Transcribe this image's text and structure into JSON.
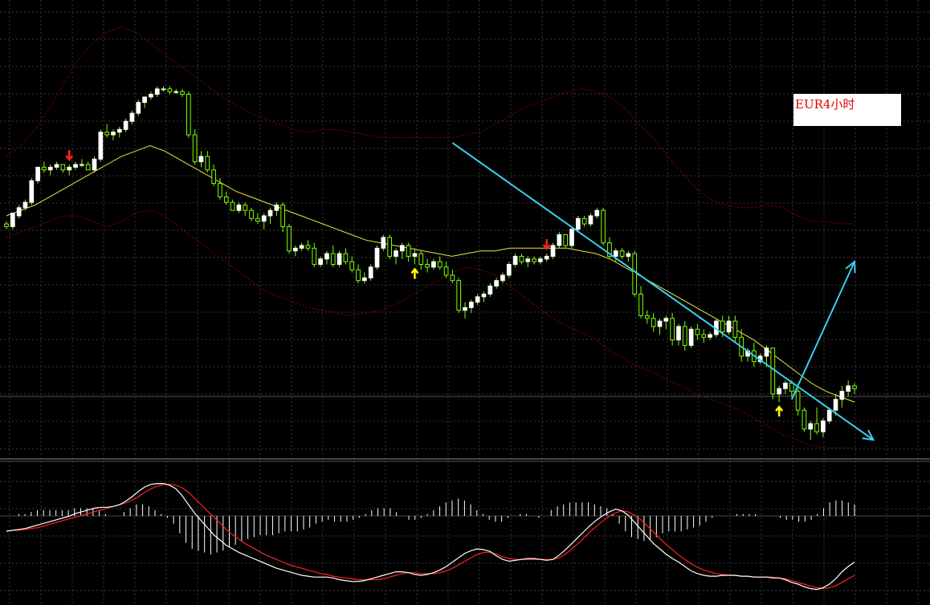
{
  "chart_label": "EUR4小时",
  "colors": {
    "background": "#000000",
    "grid": "#3a3a3a",
    "bull_candle": "#ffffff",
    "candle_wick": "#7fff00",
    "moving_average": "#e8e840",
    "bollinger_band": "#8b0000",
    "trendline": "#3ad0f0",
    "macd_line": "#ffffff",
    "signal_line": "#ff2020",
    "histogram": "#ffffff",
    "arrow_up": "#ffff00",
    "arrow_down": "#ff2020"
  },
  "chart_data": {
    "type": "candlestick",
    "price_panel": {
      "ylim": [
        0,
        100
      ],
      "candles": [
        [
          23,
          24,
          21,
          22
        ],
        [
          22,
          27,
          21,
          27
        ],
        [
          26,
          30,
          25,
          29
        ],
        [
          29,
          32,
          28,
          31
        ],
        [
          31,
          40,
          30,
          39
        ],
        [
          39,
          44,
          38,
          44
        ],
        [
          44,
          46,
          42,
          43
        ],
        [
          43,
          45,
          41,
          44
        ],
        [
          44,
          46,
          43,
          45
        ],
        [
          45,
          45,
          42,
          43
        ],
        [
          43,
          45,
          41,
          44
        ],
        [
          44,
          46,
          43,
          45
        ],
        [
          45,
          47,
          44,
          45
        ],
        [
          45,
          46,
          43,
          43
        ],
        [
          43,
          48,
          42,
          47
        ],
        [
          47,
          58,
          46,
          57
        ],
        [
          57,
          60,
          55,
          56
        ],
        [
          56,
          58,
          54,
          57
        ],
        [
          57,
          59,
          55,
          58
        ],
        [
          58,
          62,
          57,
          61
        ],
        [
          61,
          65,
          60,
          64
        ],
        [
          64,
          69,
          63,
          68
        ],
        [
          68,
          70,
          66,
          70
        ],
        [
          70,
          72,
          69,
          71
        ],
        [
          71,
          74,
          70,
          73
        ],
        [
          73,
          74,
          72,
          73
        ],
        [
          73,
          74,
          71,
          72
        ],
        [
          72,
          73,
          71,
          72
        ],
        [
          72,
          73,
          70,
          71
        ],
        [
          71,
          72,
          55,
          56
        ],
        [
          56,
          58,
          45,
          46
        ],
        [
          46,
          50,
          44,
          48
        ],
        [
          48,
          50,
          42,
          43
        ],
        [
          43,
          45,
          37,
          38
        ],
        [
          38,
          40,
          32,
          33
        ],
        [
          33,
          35,
          30,
          31
        ],
        [
          31,
          32,
          28,
          28
        ],
        [
          28,
          31,
          27,
          30
        ],
        [
          30,
          31,
          26,
          28
        ],
        [
          28,
          29,
          24,
          25
        ],
        [
          25,
          27,
          23,
          24
        ],
        [
          24,
          27,
          21,
          26
        ],
        [
          26,
          29,
          23,
          28
        ],
        [
          28,
          31,
          26,
          30
        ],
        [
          30,
          31,
          20,
          22
        ],
        [
          22,
          23,
          12,
          13
        ],
        [
          13,
          15,
          11,
          14
        ],
        [
          14,
          16,
          13,
          15
        ],
        [
          15,
          17,
          13,
          14
        ],
        [
          14,
          16,
          7,
          8
        ],
        [
          8,
          11,
          7,
          10
        ],
        [
          10,
          13,
          8,
          12
        ],
        [
          12,
          15,
          7,
          8
        ],
        [
          8,
          13,
          7,
          12
        ],
        [
          12,
          14,
          8,
          9
        ],
        [
          9,
          11,
          5,
          6
        ],
        [
          6,
          8,
          1,
          2
        ],
        [
          2,
          5,
          1,
          3
        ],
        [
          3,
          8,
          2,
          7
        ],
        [
          7,
          15,
          6,
          14
        ],
        [
          14,
          19,
          13,
          18
        ],
        [
          18,
          19,
          10,
          11
        ],
        [
          11,
          14,
          8,
          13
        ],
        [
          13,
          16,
          10,
          15
        ],
        [
          15,
          16,
          9,
          11
        ],
        [
          11,
          14,
          8,
          12
        ],
        [
          12,
          13,
          6,
          8
        ],
        [
          8,
          10,
          5,
          7
        ],
        [
          7,
          10,
          6,
          9
        ],
        [
          9,
          11,
          6,
          7
        ],
        [
          7,
          9,
          3,
          4
        ],
        [
          4,
          6,
          1,
          2
        ],
        [
          2,
          3,
          -10,
          -9
        ],
        [
          -9,
          -6,
          -12,
          -8
        ],
        [
          -8,
          -5,
          -10,
          -6
        ],
        [
          -6,
          -3,
          -7,
          -4
        ],
        [
          -4,
          -2,
          -6,
          -3
        ],
        [
          -3,
          1,
          -4,
          0
        ],
        [
          0,
          3,
          -1,
          2
        ],
        [
          2,
          5,
          1,
          4
        ],
        [
          4,
          9,
          3,
          8
        ],
        [
          8,
          12,
          7,
          11
        ],
        [
          11,
          12,
          8,
          9
        ],
        [
          9,
          11,
          7,
          10
        ],
        [
          10,
          11,
          8,
          9
        ],
        [
          9,
          11,
          8,
          10
        ],
        [
          10,
          12,
          9,
          11
        ],
        [
          11,
          16,
          10,
          15
        ],
        [
          15,
          20,
          14,
          19
        ],
        [
          19,
          18,
          14,
          15
        ],
        [
          15,
          22,
          14,
          21
        ],
        [
          21,
          26,
          20,
          25
        ],
        [
          25,
          26,
          22,
          23
        ],
        [
          23,
          27,
          22,
          26
        ],
        [
          26,
          29,
          25,
          28
        ],
        [
          28,
          29,
          15,
          16
        ],
        [
          16,
          18,
          10,
          11
        ],
        [
          11,
          14,
          9,
          13
        ],
        [
          13,
          14,
          10,
          11
        ],
        [
          11,
          13,
          9,
          12
        ],
        [
          12,
          13,
          -4,
          -3
        ],
        [
          -3,
          0,
          -12,
          -11
        ],
        [
          -11,
          -9,
          -14,
          -12
        ],
        [
          -12,
          -10,
          -17,
          -15
        ],
        [
          -15,
          -12,
          -18,
          -13
        ],
        [
          -13,
          -11,
          -16,
          -12
        ],
        [
          -12,
          -10,
          -22,
          -20
        ],
        [
          -20,
          -14,
          -22,
          -15
        ],
        [
          -15,
          -13,
          -24,
          -22
        ],
        [
          -22,
          -15,
          -23,
          -16
        ],
        [
          -16,
          -14,
          -20,
          -18
        ],
        [
          -18,
          -16,
          -21,
          -19
        ],
        [
          -19,
          -17,
          -20,
          -18
        ],
        [
          -18,
          -12,
          -19,
          -13
        ],
        [
          -13,
          -11,
          -19,
          -17
        ],
        [
          -17,
          -11,
          -18,
          -13
        ],
        [
          -13,
          -11,
          -21,
          -19
        ],
        [
          -19,
          -16,
          -28,
          -26
        ],
        [
          -26,
          -23,
          -28,
          -24
        ],
        [
          -24,
          -21,
          -30,
          -28
        ],
        [
          -28,
          -25,
          -29,
          -26
        ],
        [
          -26,
          -22,
          -30,
          -23
        ],
        [
          -23,
          -31,
          -42,
          -40
        ],
        [
          -40,
          -37,
          -43,
          -38
        ],
        [
          -38,
          -35,
          -40,
          -36
        ],
        [
          -36,
          -35,
          -41,
          -39
        ],
        [
          -39,
          -38,
          -48,
          -46
        ],
        [
          -46,
          -45,
          -54,
          -53
        ],
        [
          -53,
          -50,
          -57,
          -51
        ],
        [
          -51,
          -45,
          -55,
          -54
        ],
        [
          -54,
          -49,
          -56,
          -50
        ],
        [
          -50,
          -45,
          -51,
          -46
        ],
        [
          -46,
          -40,
          -48,
          -42
        ],
        [
          -42,
          -37,
          -45,
          -39
        ],
        [
          -39,
          -35,
          -41,
          -37
        ],
        [
          -37,
          -36,
          -40,
          -38
        ]
      ],
      "moving_average": [
        26,
        28,
        30,
        33,
        36,
        39,
        42,
        45,
        48,
        50,
        52,
        50,
        47,
        44,
        41,
        38,
        35,
        33,
        31,
        29,
        27,
        25,
        23,
        21,
        19,
        17,
        16,
        15,
        14,
        13,
        12,
        11,
        12,
        13,
        13,
        14,
        14,
        14,
        14,
        14,
        13,
        12,
        10,
        7,
        4,
        1,
        -2,
        -5,
        -8,
        -11,
        -14,
        -17,
        -20,
        -24,
        -28,
        -32,
        -36,
        -39,
        -41,
        -43
      ],
      "bollinger_upper": [
        48,
        52,
        58,
        66,
        75,
        84,
        90,
        94,
        96,
        94,
        90,
        86,
        82,
        78,
        74,
        70,
        67,
        64,
        62,
        60,
        58,
        57,
        58,
        58,
        57,
        56,
        55,
        55,
        55,
        55,
        55,
        55,
        56,
        57,
        60,
        63,
        66,
        68,
        70,
        72,
        73,
        72,
        70,
        66,
        60,
        55,
        48,
        42,
        36,
        32,
        30,
        29,
        29,
        30,
        29,
        26,
        24,
        24,
        23,
        23
      ],
      "bollinger_lower": [
        18,
        20,
        22,
        24,
        26,
        26,
        24,
        22,
        24,
        27,
        28,
        26,
        22,
        18,
        14,
        10,
        6,
        2,
        -2,
        -4,
        -6,
        -8,
        -9,
        -10,
        -11,
        -10,
        -9,
        -7,
        -4,
        -1,
        2,
        5,
        7,
        6,
        4,
        0,
        -4,
        -8,
        -12,
        -15,
        -17,
        -20,
        -24,
        -27,
        -30,
        -32,
        -35,
        -37,
        -40,
        -42,
        -44,
        -46,
        -49,
        -52,
        -55,
        -57,
        -59,
        -60,
        -60,
        -60
      ],
      "trendline": {
        "from": [
          71,
          53
        ],
        "to": [
          138,
          -57
        ]
      },
      "projection_arrow": {
        "from": [
          125,
          -42
        ],
        "to": [
          135,
          9
        ]
      },
      "signal_arrows": [
        {
          "direction": "down",
          "index": 10
        },
        {
          "direction": "up",
          "index": 65
        },
        {
          "direction": "down",
          "index": 86
        },
        {
          "direction": "up",
          "index": 123
        }
      ]
    },
    "macd_panel": {
      "macd": [
        -20,
        -19,
        -18,
        -17,
        -15,
        -13,
        -11,
        -9,
        -7,
        -5,
        -3,
        0,
        2,
        4,
        6,
        7,
        7,
        8,
        10,
        14,
        19,
        25,
        30,
        33,
        34,
        34,
        32,
        28,
        20,
        10,
        0,
        -8,
        -16,
        -24,
        -30,
        -36,
        -40,
        -44,
        -47,
        -50,
        -53,
        -56,
        -59,
        -62,
        -64,
        -66,
        -68,
        -70,
        -71,
        -72,
        -72,
        -72,
        -73,
        -75,
        -76,
        -77,
        -77,
        -76,
        -74,
        -72,
        -70,
        -68,
        -66,
        -66,
        -67,
        -69,
        -70,
        -69,
        -67,
        -64,
        -60,
        -55,
        -50,
        -45,
        -42,
        -40,
        -41,
        -43,
        -48,
        -52,
        -54,
        -53,
        -52,
        -51,
        -51,
        -52,
        -53,
        -52,
        -47,
        -41,
        -34,
        -27,
        -20,
        -13,
        -7,
        -2,
        2,
        5,
        3,
        -2,
        -10,
        -18,
        -26,
        -34,
        -40,
        -46,
        -51,
        -55,
        -60,
        -65,
        -68,
        -70,
        -71,
        -71,
        -70,
        -70,
        -70,
        -71,
        -71,
        -72,
        -72,
        -72,
        -73,
        -73,
        -75,
        -78,
        -80,
        -83,
        -85,
        -86,
        -84,
        -80,
        -74,
        -66,
        -60,
        -55
      ],
      "signal": [
        -20,
        -19,
        -19,
        -18,
        -17,
        -16,
        -14,
        -12,
        -10,
        -8,
        -6,
        -4,
        -2,
        0,
        2,
        4,
        6,
        8,
        10,
        12,
        15,
        19,
        24,
        28,
        31,
        33,
        33,
        32,
        29,
        24,
        17,
        10,
        3,
        -4,
        -11,
        -18,
        -24,
        -29,
        -34,
        -38,
        -42,
        -46,
        -49,
        -52,
        -55,
        -58,
        -60,
        -62,
        -64,
        -66,
        -68,
        -69,
        -71,
        -72,
        -73,
        -74,
        -75,
        -75,
        -75,
        -75,
        -74,
        -72,
        -70,
        -68,
        -67,
        -67,
        -68,
        -68,
        -68,
        -67,
        -65,
        -62,
        -58,
        -54,
        -50,
        -46,
        -44,
        -44,
        -46,
        -49,
        -51,
        -52,
        -52,
        -52,
        -52,
        -52,
        -52,
        -52,
        -50,
        -46,
        -40,
        -34,
        -27,
        -20,
        -14,
        -8,
        -3,
        1,
        3,
        2,
        -2,
        -7,
        -14,
        -21,
        -28,
        -35,
        -41,
        -47,
        -52,
        -57,
        -61,
        -64,
        -66,
        -68,
        -69,
        -70,
        -70,
        -71,
        -71,
        -72,
        -72,
        -72,
        -72,
        -73,
        -74,
        -76,
        -78,
        -80,
        -82,
        -84,
        -85,
        -84,
        -82,
        -78,
        -74,
        -70
      ],
      "histogram": [
        0,
        0,
        1,
        1,
        2,
        3,
        3,
        3,
        3,
        3,
        3,
        4,
        4,
        4,
        4,
        3,
        1,
        0,
        0,
        2,
        4,
        6,
        6,
        5,
        3,
        1,
        -1,
        -4,
        -9,
        -14,
        -17,
        -18,
        -19,
        -20,
        -19,
        -18,
        -16,
        -15,
        -13,
        -12,
        -11,
        -10,
        -10,
        -10,
        -9,
        -8,
        -8,
        -8,
        -7,
        -6,
        -4,
        -3,
        -2,
        -3,
        -3,
        -3,
        -2,
        -1,
        1,
        3,
        4,
        4,
        4,
        2,
        0,
        -2,
        -2,
        -1,
        1,
        3,
        5,
        7,
        8,
        9,
        8,
        6,
        3,
        1,
        -2,
        -3,
        -3,
        -1,
        0,
        1,
        1,
        0,
        -1,
        0,
        3,
        5,
        6,
        7,
        7,
        7,
        7,
        6,
        5,
        4,
        1,
        -4,
        -8,
        -11,
        -12,
        -13,
        -12,
        -11,
        -9,
        -8,
        -8,
        -8,
        -7,
        -6,
        -5,
        -3,
        -1,
        0,
        0,
        0,
        1,
        1,
        1,
        1,
        0,
        0,
        0,
        -1,
        -2,
        -2,
        -3,
        -3,
        -2,
        1,
        4,
        7,
        8,
        8,
        7,
        6
      ],
      "ylim": [
        -100,
        50
      ]
    }
  }
}
